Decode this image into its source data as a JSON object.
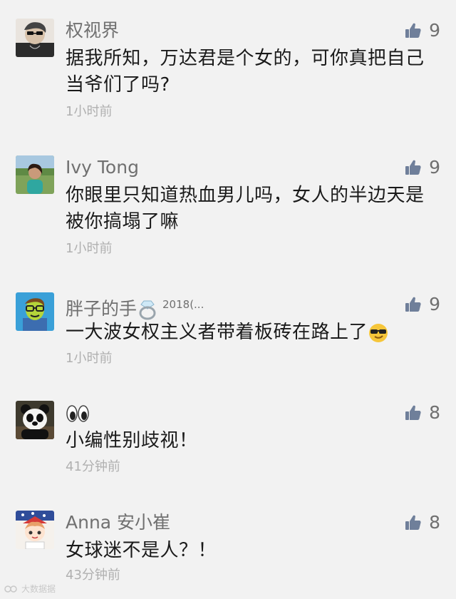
{
  "comments": [
    {
      "username": "权视界",
      "likes": "9",
      "content": "据我所知，万达君是个女的，可你真把自己当爷们了吗?",
      "time": "1小时前",
      "avatar": "avatar-man-sunglasses"
    },
    {
      "username": "Ivy Tong",
      "likes": "9",
      "content": "你眼里只知道热血男儿吗，女人的半边天是被你搞塌了嘛",
      "time": "1小时前",
      "avatar": "avatar-woman-outdoor"
    },
    {
      "username": "胖子的手",
      "username_badge": "2018(...",
      "likes": "9",
      "content": "一大波女权主义者带着板砖在路上了",
      "time": "1小时前",
      "avatar": "avatar-cartoon-glasses-man",
      "username_icon": "ring-icon",
      "content_emoji": "cool-sunglasses-emoji"
    },
    {
      "username": "",
      "likes": "8",
      "content": "小编性别歧视！",
      "time": "41分钟前",
      "avatar": "avatar-panda",
      "username_icon": "eyes-emoji"
    },
    {
      "username": "Anna 安小崔",
      "likes": "8",
      "content": "女球迷不是人？！",
      "time": "43分钟前",
      "avatar": "avatar-anime-girl"
    }
  ],
  "colors": {
    "background": "#f2f2f2",
    "username": "#707070",
    "content": "#1a1a1a",
    "timestamp": "#b0b0b0",
    "like_icon": "#6f7f9a"
  },
  "watermark": {
    "text": "大数据据"
  }
}
